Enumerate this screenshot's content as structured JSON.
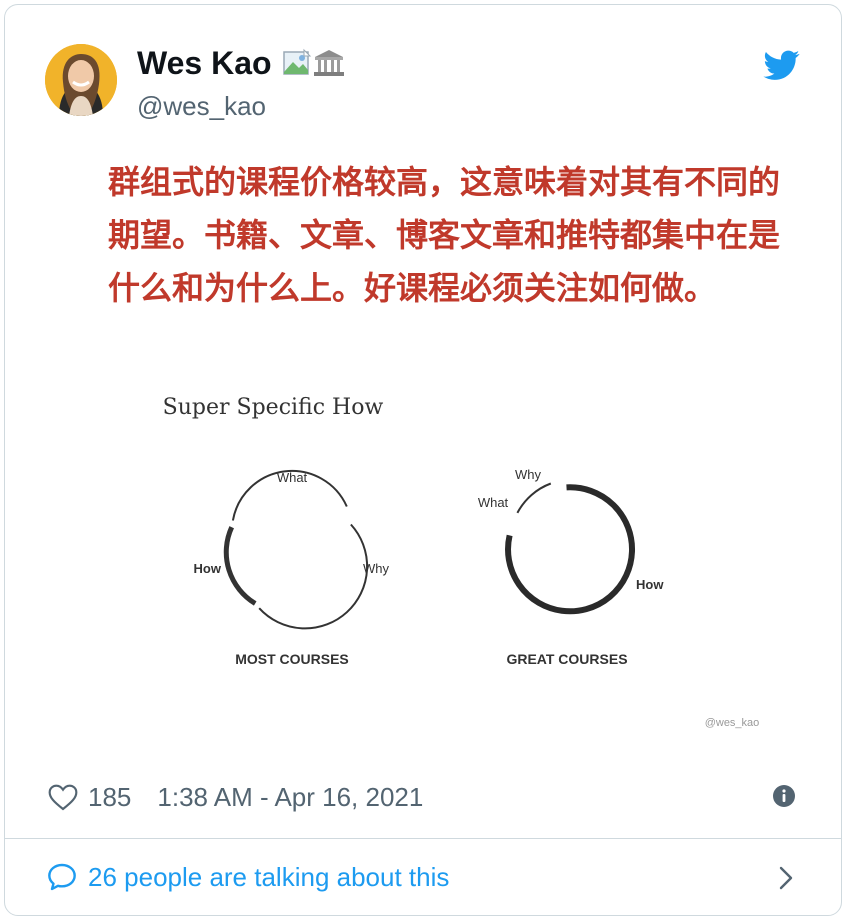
{
  "tweet": {
    "display_name": "Wes Kao",
    "handle": "@wes_kao",
    "badges": [
      "broken-image-icon",
      "classical-building-icon"
    ],
    "text": "群组式的课程价格较高，这意味着对其有不同的期望。书籍、文章、博客文章和推特都集中在是什么和为什么上。好课程必须关注如何做。",
    "likes": "185",
    "timestamp": "1:38 AM - Apr 16, 2021",
    "talking": "26 people are talking about this"
  },
  "figure": {
    "title": "Super Specific How",
    "watermark": "@wes_kao",
    "diagrams": [
      {
        "caption": "MOST COURSES",
        "labels": {
          "what": "What",
          "why": "Why",
          "how": "How"
        },
        "emphasis": "How is a small thick segment; What and Why dominate"
      },
      {
        "caption": "GREAT COURSES",
        "labels": {
          "what": "What",
          "why": "Why",
          "how": "How"
        },
        "emphasis": "How is the dominant thick segment"
      }
    ]
  },
  "colors": {
    "tweet_text": "#c0392b",
    "link": "#1d9bf0",
    "secondary": "#536471",
    "twitter_blue": "#1d9bf0",
    "avatar_bg": "#f1b32a"
  }
}
